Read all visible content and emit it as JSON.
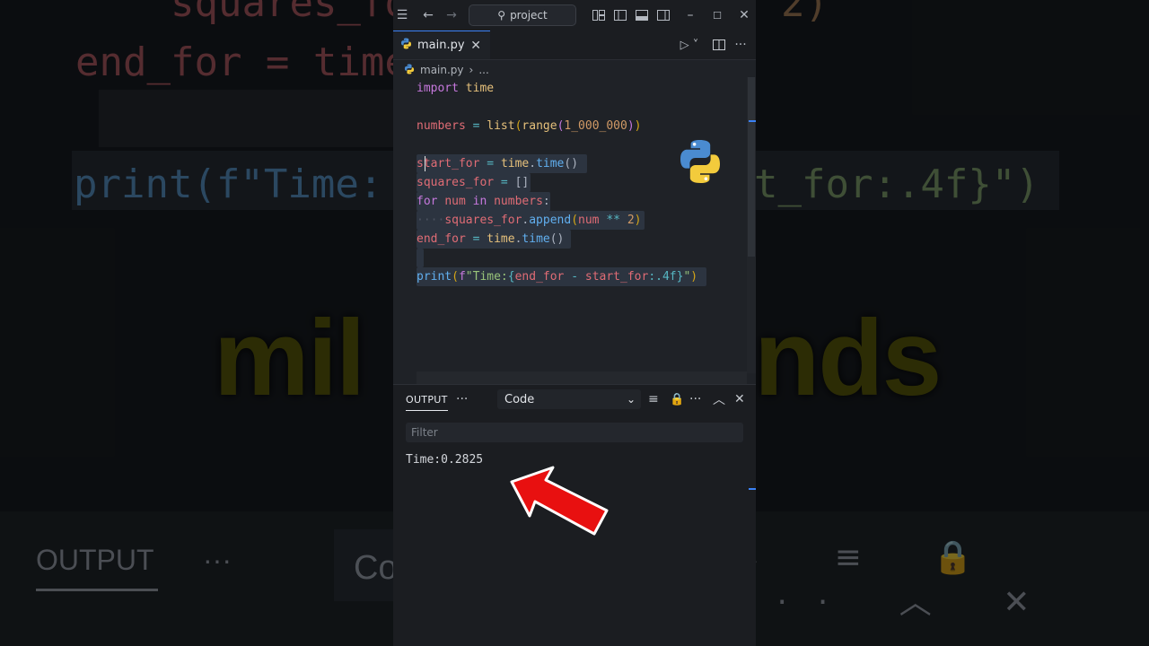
{
  "titlebar": {
    "search_label": "project",
    "icons": [
      "menu-icon",
      "back-icon",
      "forward-icon",
      "search-icon",
      "layout-icon",
      "sidebar-left-icon",
      "panel-icon",
      "sidebar-right-icon",
      "minimize-icon",
      "maximize-icon",
      "close-icon"
    ]
  },
  "tab": {
    "label": "main.py"
  },
  "breadcrumb": {
    "file": "main.py",
    "more": "..."
  },
  "editor": {
    "lines": [
      "import time",
      "",
      "numbers = list(range(1_000_000))",
      "",
      "start_for = time.time()",
      "squares_for = []",
      "for num in numbers:",
      "    squares_for.append(num ** 2)",
      "end_for = time.time()",
      "",
      "print(f\"Time:{end_for - start_for:.4f}\")"
    ]
  },
  "caption": "milliseconds",
  "panel": {
    "tab_label": "OUTPUT",
    "more": "···",
    "channel": "Code",
    "filter_placeholder": "Filter",
    "output": "Time:0.2825"
  },
  "background": {
    "code_line_1": "squares_fo",
    "code_line_1_end": "2)",
    "code_line_2": "end_for = time",
    "code_line_3": "print(f\"Time:",
    "code_line_3_end": "t_for:.4f}\")",
    "word_left": "mil",
    "word_right": "nds",
    "output_label": "OUTPUT",
    "dots": "···",
    "dropdown_fragment": "Co"
  },
  "colors": {
    "accent": "#3b82f6",
    "caption": "#f5e51b",
    "arrow": "#e81010"
  }
}
